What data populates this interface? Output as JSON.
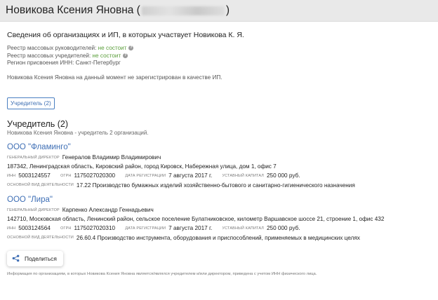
{
  "header": {
    "name": "Новикова Ксения Яновна (",
    "close_paren": ")"
  },
  "summary": {
    "title": "Сведения об организациях и ИП, в которых участвует Новикова К. Я.",
    "rows": [
      {
        "label": "Реестр массовых руководителей: ",
        "value": "не состоит"
      },
      {
        "label": "Реестр массовых учредителей: ",
        "value": "не состоит"
      }
    ],
    "region": "Регион присвоения ИНН: Санкт-Петербург",
    "ip_note": "Новикова Ксения Яновна на данный момент не зарегистрирован в качестве ИП."
  },
  "tab_button": "Учредитель (2)",
  "section": {
    "title": "Учредитель (2)",
    "subtitle": "Новикова Ксения Яновна - учредитель 2 организаций."
  },
  "labels": {
    "director": "ГЕНЕРАЛЬНЫЙ ДИРЕКТОР",
    "inn": "ИНН",
    "ogrn": "ОГРН",
    "reg_date": "ДАТА РЕГИСТРАЦИИ",
    "capital": "УСТАВНЫЙ КАПИТАЛ",
    "activity": "ОСНОВНОЙ ВИД ДЕЯТЕЛЬНОСТИ"
  },
  "orgs": [
    {
      "name": "ООО \"Фламинго\"",
      "director": "Генералов Владимир Владимирович",
      "address": "187342, Ленинградская область, Кировский район, город Кировск, Набережная улица, дом 1, офис 7",
      "inn": "5003124557",
      "ogrn": "1175027020300",
      "reg_date": "7 августа 2017 г.",
      "capital": "250 000 руб.",
      "activity": "17.22 Производство бумажных изделий хозяйственно-бытового и санитарно-гигиенического назначения"
    },
    {
      "name": "ООО \"Лира\"",
      "director": "Карпенко Александр Геннадьевич",
      "address": "142710, Московская область, Ленинский район, сельское поселение Булатниковское, километр Варшавское шоссе 21, строение 1, офис 432",
      "inn": "5003124564",
      "ogrn": "1175027020310",
      "reg_date": "7 августа 2017 г.",
      "capital": "250 000 руб.",
      "activity": "26.60.4 Производство инструмента, оборудования и приспособлений, применяемых в медицинских целях"
    }
  ],
  "share_label": "Поделиться",
  "footer": "Информация по организациям, в которых Новикова Ксения Яновна является/являлся учредителем и/или директором, приведена с учетом ИНН физического лица.",
  "colors": {
    "link": "#3f6fb5",
    "ok": "#5a9e3a",
    "header_bg": "#e9e9e9"
  }
}
